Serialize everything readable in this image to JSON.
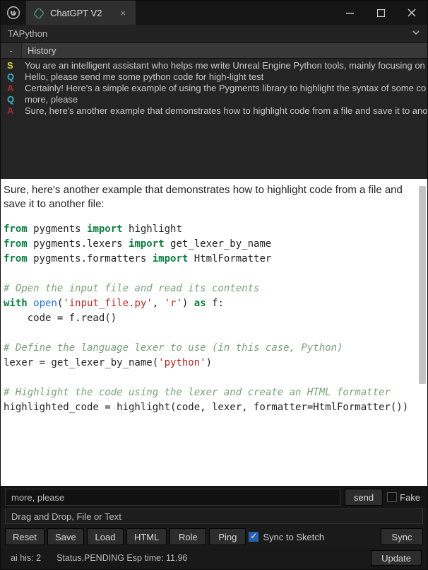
{
  "window": {
    "tab_title": "ChatGPT V2"
  },
  "subheader": {
    "label": "TAPython"
  },
  "history": {
    "dash": "-",
    "label": "History",
    "items": [
      {
        "role": "S",
        "text": "You are an intelligent assistant who helps me write Unreal Engine Python tools, mainly focusing on"
      },
      {
        "role": "Q",
        "text": "Hello, please send me some python code for high-light test"
      },
      {
        "role": "A",
        "text": "Certainly! Here's a simple example of using the Pygments library to highlight the syntax of some co"
      },
      {
        "role": "Q",
        "text": "more, please"
      },
      {
        "role": "A",
        "text": "Sure, here's another example that demonstrates how to highlight code from a file and save it to ano"
      }
    ]
  },
  "content": {
    "intro": "Sure, here's another example that demonstrates how to highlight code from a file and save it to another file:",
    "code": {
      "l1a": "from",
      "l1b": " pygments ",
      "l1c": "import",
      "l1d": " highlight",
      "l2a": "from",
      "l2b": " pygments.lexers ",
      "l2c": "import",
      "l2d": " get_lexer_by_name",
      "l3a": "from",
      "l3b": " pygments.formatters ",
      "l3c": "import",
      "l3d": " HtmlFormatter",
      "blank1": "",
      "c1": "# Open the input file and read its contents",
      "l4a": "with",
      "l4b": " ",
      "l4c": "open",
      "l4d": "(",
      "l4e": "'input_file.py'",
      "l4f": ", ",
      "l4g": "'r'",
      "l4h": ") ",
      "l4i": "as",
      "l4j": " f:",
      "l5": "    code = f.read()",
      "blank2": "",
      "c2": "# Define the language lexer to use (in this case, Python)",
      "l6a": "lexer = get_lexer_by_name(",
      "l6b": "'python'",
      "l6c": ")",
      "blank3": "",
      "c3": "# Highlight the code using the lexer and create an HTML formatter",
      "l7": "highlighted_code = highlight(code, lexer, formatter=HtmlFormatter())"
    }
  },
  "input": {
    "value": "more, please",
    "send_label": "send",
    "fake_label": "Fake"
  },
  "dragdrop": {
    "label": "Drag and Drop, File or Text"
  },
  "buttons": {
    "reset": "Reset",
    "save": "Save",
    "load": "Load",
    "html": "HTML",
    "role": "Role",
    "ping": "Ping",
    "sync_sketch": "Sync to Sketch",
    "sync": "Sync"
  },
  "status": {
    "ai_his": "ai his: 2",
    "pending": "Status.PENDING  Esp time: 11.96",
    "update": "Update"
  }
}
